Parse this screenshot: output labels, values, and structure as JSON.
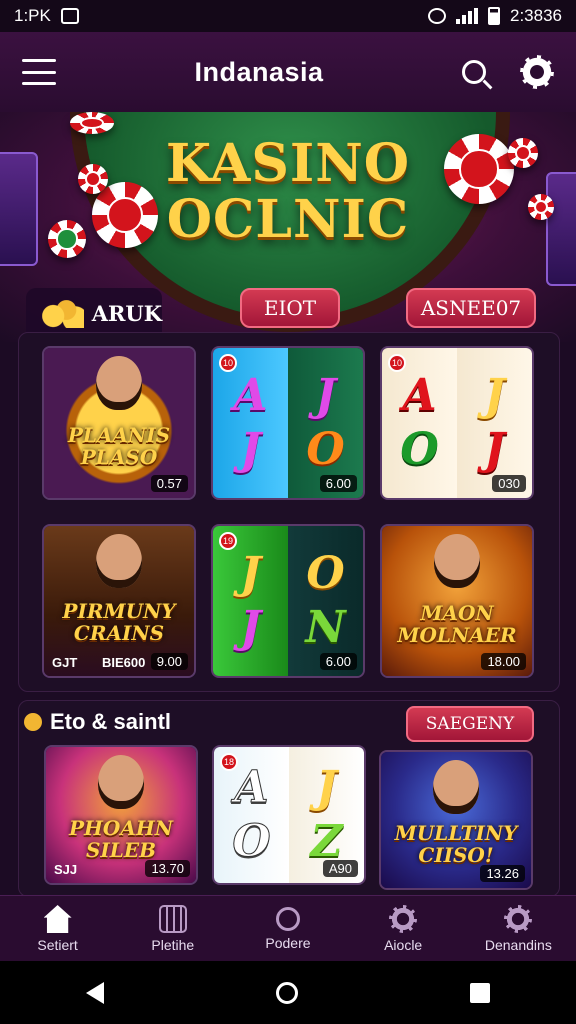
{
  "status_bar": {
    "time": "1:PK",
    "right_time": "2:3836"
  },
  "app_bar": {
    "title": "Indanasia",
    "icons": [
      "menu-icon",
      "search-icon",
      "settings-icon"
    ]
  },
  "hero": {
    "title_line1": "KASINO",
    "title_line2": "OCLNIC",
    "label": "ARUK",
    "button_left": "EIOT",
    "button_right": "ASNEE07"
  },
  "games": [
    {
      "name": "PLAANIS PLASO",
      "price": "0.57"
    },
    {
      "reels": [
        "A",
        "J",
        "J",
        "O"
      ],
      "price": "6.00",
      "badge": "10"
    },
    {
      "reels": [
        "A",
        "J",
        "O",
        "J"
      ],
      "price": "030",
      "badge": "10"
    },
    {
      "name": "PIRMUNY CRAINS",
      "code": "GJT",
      "sub": "BIE600",
      "price": "9.00"
    },
    {
      "reels": [
        "J",
        "O",
        "J",
        "N"
      ],
      "price": "6.00",
      "badge": "19"
    },
    {
      "name": "MAON MOLNAER",
      "price": "18.00"
    }
  ],
  "section": {
    "title": "Eto & saintl",
    "button": "SAEGENY",
    "games": [
      {
        "name": "PHOAHN SILEB",
        "code": "SJJ",
        "price": "13.70"
      },
      {
        "reels": [
          "A",
          "J",
          "O",
          "Z"
        ],
        "price": "A90",
        "badge": "18"
      },
      {
        "name": "MULLTINY CIISO!",
        "price": "13.26"
      }
    ]
  },
  "bottom_nav": [
    {
      "label": "Setiert",
      "icon": "home-icon"
    },
    {
      "label": "Pletihe",
      "icon": "grid-icon"
    },
    {
      "label": "Podere",
      "icon": "search-icon"
    },
    {
      "label": "Aiocle",
      "icon": "gear-icon"
    },
    {
      "label": "Denandins",
      "icon": "settings-icon"
    }
  ],
  "colors": {
    "accent": "#a21638",
    "gold": "#ffd24a",
    "background": "#1c0b24"
  }
}
